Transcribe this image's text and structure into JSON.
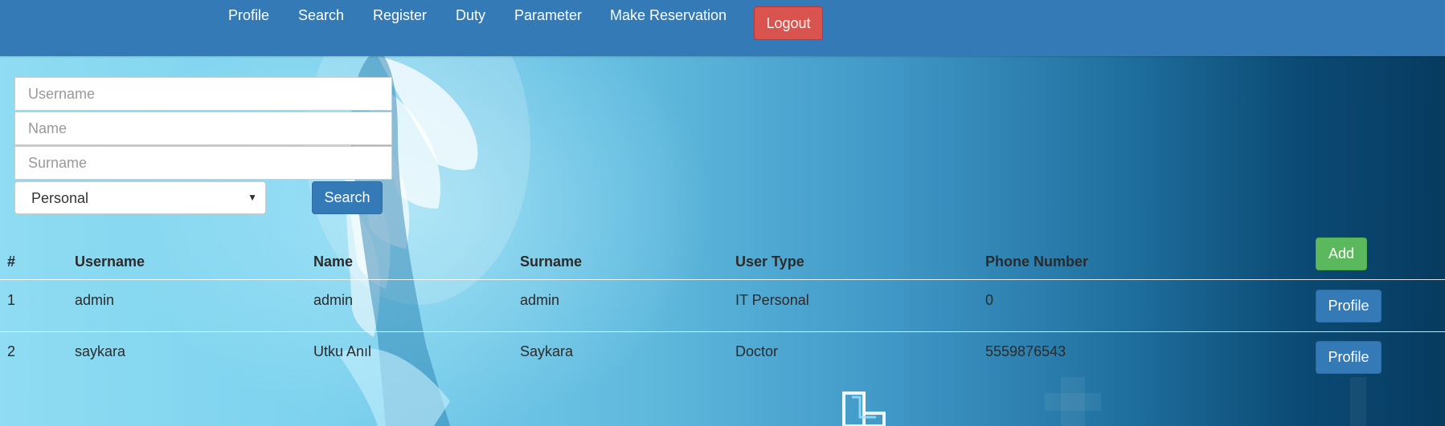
{
  "nav": {
    "items": [
      {
        "label": "Profile"
      },
      {
        "label": "Search"
      },
      {
        "label": "Register"
      },
      {
        "label": "Duty"
      },
      {
        "label": "Parameter"
      },
      {
        "label": "Make Reservation"
      }
    ],
    "logout_label": "Logout"
  },
  "search_form": {
    "username_placeholder": "Username",
    "name_placeholder": "Name",
    "surname_placeholder": "Surname",
    "user_type_selected": "Personal",
    "search_label": "Search"
  },
  "table": {
    "headers": [
      "#",
      "Username",
      "Name",
      "Surname",
      "User Type",
      "Phone Number"
    ],
    "add_label": "Add",
    "rows": [
      {
        "num": "1",
        "username": "admin",
        "name": "admin",
        "surname": "admin",
        "user_type": "IT Personal",
        "phone": "0",
        "action": "Profile"
      },
      {
        "num": "2",
        "username": "saykara",
        "name": "Utku Anıl",
        "surname": "Saykara",
        "user_type": "Doctor",
        "phone": "5559876543",
        "action": "Profile"
      }
    ]
  },
  "colors": {
    "navbar": "#337ab7",
    "logout": "#d9534f",
    "primary": "#337ab7",
    "success": "#5cb85c"
  }
}
